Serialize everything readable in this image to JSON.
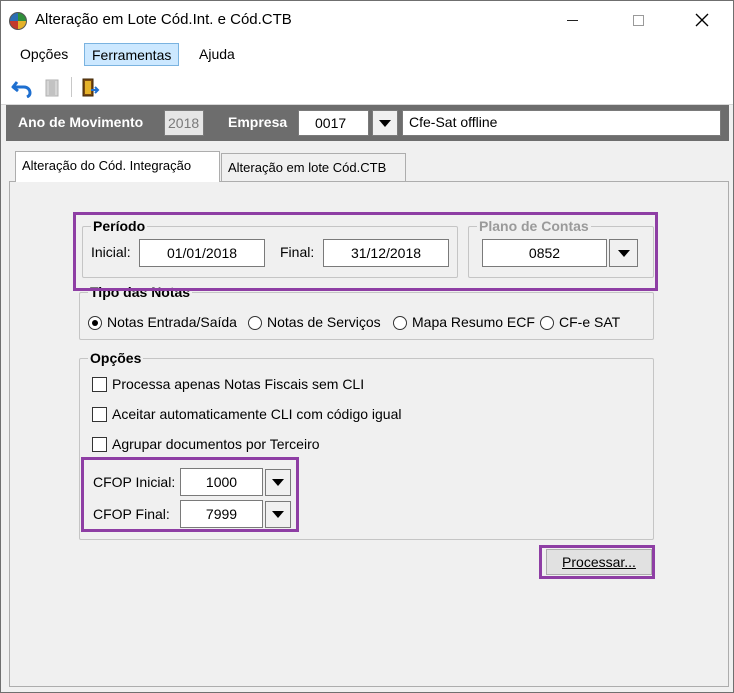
{
  "window": {
    "title": "Alteração em Lote Cód.Int. e Cód.CTB"
  },
  "menu": {
    "items": [
      "Opções",
      "Ferramentas",
      "Ajuda"
    ]
  },
  "toolbar": {
    "icons": [
      "undo-icon",
      "document-icon",
      "exit-door-icon"
    ]
  },
  "filterbar": {
    "ano_label": "Ano de Movimento",
    "ano_value": "2018",
    "empresa_label": "Empresa",
    "empresa_code": "0017",
    "empresa_name": "Cfe-Sat  offline"
  },
  "tabs": [
    "Alteração do Cód. Integração",
    "Alteração em lote Cód.CTB"
  ],
  "periodo": {
    "title": "Período",
    "inicial_label": "Inicial:",
    "inicial_value": "01/01/2018",
    "final_label": "Final:",
    "final_value": "31/12/2018"
  },
  "plano": {
    "title": "Plano de Contas",
    "value": "0852"
  },
  "tipo_notas": {
    "title": "Tipo das Notas",
    "options": [
      "Notas Entrada/Saída",
      "Notas de Serviços",
      "Mapa Resumo ECF",
      "CF-e SAT"
    ],
    "selected": "Notas Entrada/Saída"
  },
  "opcoes": {
    "title": "Opções",
    "checkboxes": [
      "Processa apenas Notas Fiscais sem CLI",
      "Aceitar automaticamente CLI com código igual",
      "Agrupar documentos por Terceiro"
    ],
    "cfop_inicial_label": "CFOP Inicial:",
    "cfop_inicial_value": "1000",
    "cfop_final_label": "CFOP Final:",
    "cfop_final_value": "7999"
  },
  "processar_button": "Processar...",
  "colors": {
    "highlight": "#8e3ea4",
    "filterbar": "#6d6d6d",
    "menu_active": "#cce8ff"
  }
}
